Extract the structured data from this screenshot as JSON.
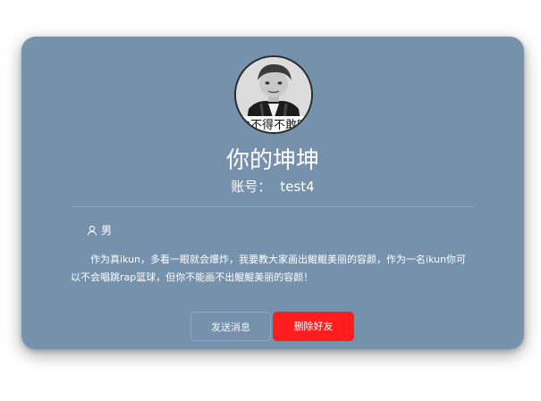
{
  "profile": {
    "avatar_caption": "舍不得不敢吃",
    "name": "你的坤坤",
    "account_label": "账号：",
    "account_value": "test4",
    "gender": "男",
    "bio": "作为真ikun，多看一眼就会爆炸，我要教大家画出鲲鲲美丽的容颜，作为一名ikun你可以不会唱跳rap篮球，但你不能画不出鲲鲲美丽的容颜！"
  },
  "actions": {
    "send_message": "发送消息",
    "delete_friend": "删除好友"
  },
  "colors": {
    "card_background": "#7591ab",
    "delete_button": "#ff1d1d",
    "text": "#ffffff"
  },
  "icons": {
    "gender": "user-outline-icon"
  }
}
